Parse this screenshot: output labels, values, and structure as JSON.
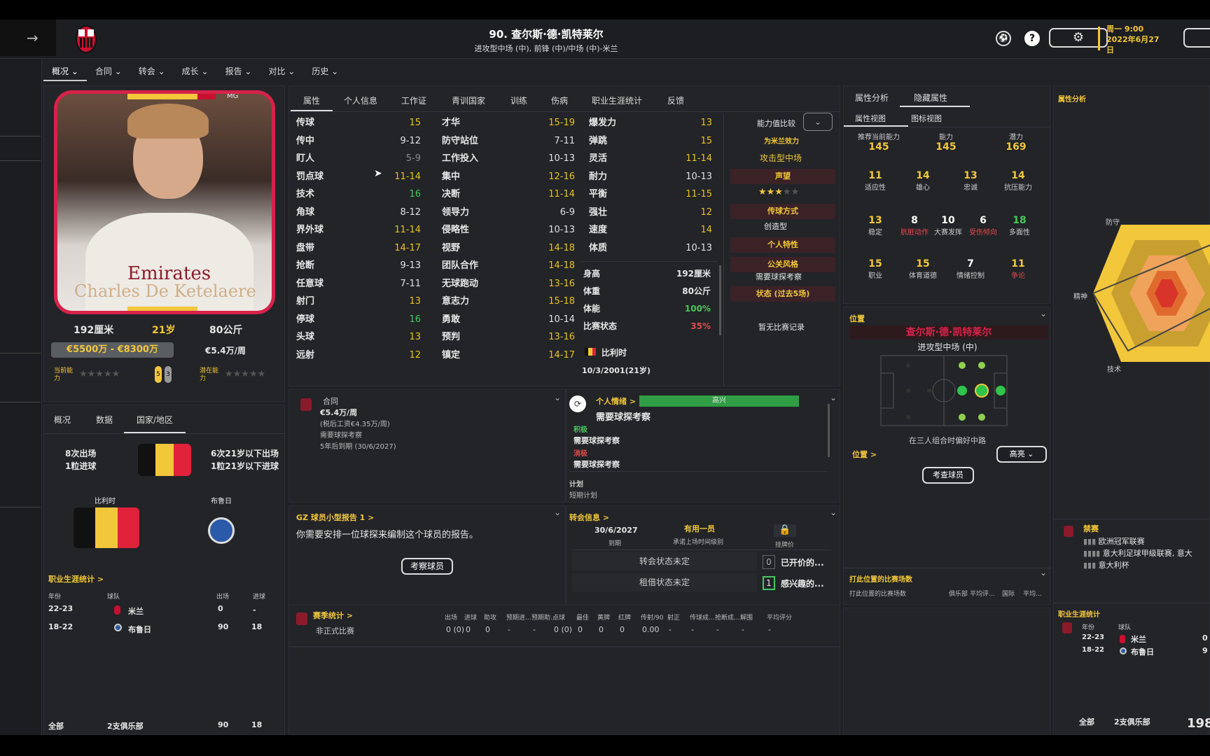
{
  "header": {
    "title": "90. 查尔斯·德·凯特莱尔",
    "subtitle": "进攻型中场 (中), 前锋 (中)/中场 (中)-米兰",
    "date_line1": "周一 9:00",
    "date_line2": "2022年6月27",
    "date_line3": "日",
    "club_badge_text": "ACM"
  },
  "menu": [
    "概况",
    "合同",
    "转会",
    "成长",
    "报告",
    "对比",
    "历史"
  ],
  "player_card": {
    "watermark": "Charles De Ketelaere",
    "height": "192厘米",
    "age": "21岁",
    "weight": "80公斤",
    "value": "€5500万 - €8300万",
    "wage": "€5.4万/周",
    "current_ability": "当前能力",
    "potential_ability": "潜在能力",
    "badge_a": "5",
    "badge_b": "3",
    "mg": "MG"
  },
  "left_tabs": [
    "概况",
    "数据",
    "国家/地区"
  ],
  "nation": {
    "apps": "8次出场",
    "goals": "1粒进球",
    "u21_apps": "6次21岁以下出场",
    "u21_goals": "1粒21岁以下进球",
    "nation": "比利时",
    "club": "布鲁日"
  },
  "career_left": {
    "title": "职业生涯统计 >",
    "headers": [
      "年份",
      "球队",
      "出场",
      "进球"
    ],
    "rows": [
      {
        "y": "22-23",
        "team": "米兰",
        "apps": "0",
        "goals": "-"
      },
      {
        "y": "18-22",
        "team": "布鲁日",
        "apps": "90",
        "goals": "18"
      }
    ],
    "total": {
      "label": "全部",
      "clubs": "2支俱乐部",
      "apps": "90",
      "goals": "18"
    }
  },
  "center_tabs": [
    "属性",
    "个人信息",
    "工作证",
    "青训国家",
    "训练",
    "伤病",
    "职业生涯统计",
    "反馈"
  ],
  "attrs_col1": [
    {
      "k": "传球",
      "v": "15",
      "c": "y"
    },
    {
      "k": "传中",
      "v": "9-12",
      "c": "w"
    },
    {
      "k": "盯人",
      "v": "5-9",
      "c": "gr"
    },
    {
      "k": "罚点球",
      "v": "11-14",
      "c": "y"
    },
    {
      "k": "技术",
      "v": "16",
      "c": "g"
    },
    {
      "k": "角球",
      "v": "8-12",
      "c": "w"
    },
    {
      "k": "界外球",
      "v": "11-14",
      "c": "y"
    },
    {
      "k": "盘带",
      "v": "14-17",
      "c": "y"
    },
    {
      "k": "抢断",
      "v": "9-13",
      "c": "w"
    },
    {
      "k": "任意球",
      "v": "7-11",
      "c": "w"
    },
    {
      "k": "射门",
      "v": "13",
      "c": "y"
    },
    {
      "k": "停球",
      "v": "16",
      "c": "g"
    },
    {
      "k": "头球",
      "v": "13",
      "c": "y"
    },
    {
      "k": "远射",
      "v": "12",
      "c": "y"
    }
  ],
  "attrs_col2": [
    {
      "k": "才华",
      "v": "15-19",
      "c": "y"
    },
    {
      "k": "防守站位",
      "v": "7-11",
      "c": "w"
    },
    {
      "k": "工作投入",
      "v": "10-13",
      "c": "w"
    },
    {
      "k": "集中",
      "v": "12-16",
      "c": "y"
    },
    {
      "k": "决断",
      "v": "11-14",
      "c": "y"
    },
    {
      "k": "领导力",
      "v": "6-9",
      "c": "w"
    },
    {
      "k": "侵略性",
      "v": "10-13",
      "c": "w"
    },
    {
      "k": "视野",
      "v": "14-18",
      "c": "y"
    },
    {
      "k": "团队合作",
      "v": "14-18",
      "c": "y"
    },
    {
      "k": "无球跑动",
      "v": "13-16",
      "c": "y"
    },
    {
      "k": "意志力",
      "v": "15-18",
      "c": "y"
    },
    {
      "k": "勇敢",
      "v": "10-14",
      "c": "w"
    },
    {
      "k": "预判",
      "v": "13-16",
      "c": "y"
    },
    {
      "k": "镇定",
      "v": "14-17",
      "c": "y"
    }
  ],
  "attrs_col3": [
    {
      "k": "爆发力",
      "v": "13",
      "c": "y"
    },
    {
      "k": "弹跳",
      "v": "15",
      "c": "y"
    },
    {
      "k": "灵活",
      "v": "11-14",
      "c": "y"
    },
    {
      "k": "耐力",
      "v": "10-13",
      "c": "w"
    },
    {
      "k": "平衡",
      "v": "11-15",
      "c": "y"
    },
    {
      "k": "强壮",
      "v": "12",
      "c": "y"
    },
    {
      "k": "速度",
      "v": "14",
      "c": "y"
    },
    {
      "k": "体质",
      "v": "10-13",
      "c": "w"
    }
  ],
  "physical": [
    {
      "k": "身高",
      "v": "192厘米"
    },
    {
      "k": "体重",
      "v": "80公斤"
    },
    {
      "k": "体能",
      "v": "100%"
    },
    {
      "k": "比赛状态",
      "v": "35%"
    }
  ],
  "nationality": "比利时",
  "dob": "10/3/2001(21岁)",
  "side": {
    "compare": "能力值比较",
    "for_milan": "为米兰效力",
    "role": "攻击型中场",
    "reputation": "声望",
    "style_title": "传球方式",
    "style_value": "创造型",
    "traits": "个人特性",
    "pr_title": "公关风格",
    "pr_value": "需要球探考察",
    "form": "状态 (过去5场)",
    "no_record": "暂无比赛记录"
  },
  "contract": {
    "title": "合同",
    "wage": "€5.4万/周",
    "after_tax": "(税后工资€4.35万/周)",
    "scout": "需要球探考察",
    "expiry": "5年后到期 (30/6/2027)"
  },
  "mood": {
    "title": "个人情绪 >",
    "level": "高兴",
    "scout": "需要球探考察",
    "pos_title": "积极",
    "pos_value": "需要球探考察",
    "neg_title": "消极",
    "neg_value": "需要球探考察",
    "plan_title": "计划",
    "plan_value": "短期计划"
  },
  "report": {
    "title": "GZ 球员小型报告 1 >",
    "text": "你需要安排一位球探来编制这个球员的报告。",
    "button": "考察球员"
  },
  "transfer": {
    "title": "转会信息 >",
    "date": "30/6/2027",
    "date_label": "到期",
    "status": "有用一员",
    "status_label": "承诺上场时间级别",
    "price_label": "挂牌价",
    "transfer_state": "转会状态未定",
    "loan_state": "租借状态未定",
    "offers_n": "0",
    "offers": "已开价的...",
    "interest_n": "1",
    "interest": "感兴趣的..."
  },
  "season": {
    "title": "赛季统计 >",
    "headers": [
      "出场",
      "进球",
      "助攻",
      "预期进...",
      "预期助...",
      "点球",
      "最佳",
      "黄牌",
      "红牌",
      "传射/90",
      "射正",
      "传球成...",
      "抢断成...",
      "解围",
      "平均评分"
    ],
    "row_label": "非正式比赛",
    "row": [
      "0 (0)",
      "0",
      "0",
      "-",
      "-",
      "0 (0)",
      "0",
      "0",
      "0",
      "0.00",
      "-",
      "-",
      "-",
      "-",
      "-"
    ]
  },
  "right": {
    "tab1": "属性分析",
    "tab2": "隐藏属性",
    "view1": "属性视图",
    "view2": "图标视图",
    "rec": "推荐当前能力",
    "rec_v": "145",
    "ca": "能力",
    "ca_v": "145",
    "pa": "潜力",
    "pa_v": "169",
    "pos_title": "位置",
    "player_name": "查尔斯·德·凯特莱尔",
    "pos_role": "进攻型中场 (中)",
    "trio": "在三人组合时偏好中路",
    "pos_link": "位置 >",
    "highlight": "高亮",
    "view_btn": "考查球员",
    "matches_title": "打此位置的比赛场数",
    "matches_sub": "打此位置的比赛场数",
    "matches_cols": [
      "俱乐部",
      "平均评...",
      "国际",
      "平均..."
    ]
  },
  "hidden": [
    {
      "n": "11",
      "l": "适应性"
    },
    {
      "n": "14",
      "l": "雄心"
    },
    {
      "n": "13",
      "l": "忠诚"
    },
    {
      "n": "14",
      "l": "抗压能力"
    },
    {
      "n": "13",
      "l": "稳定"
    },
    {
      "n": "8",
      "l": "肮脏动作",
      "lc": "r",
      "nc": "w"
    },
    {
      "n": "10",
      "l": "大赛发挥",
      "nc": "w"
    },
    {
      "n": "6",
      "l": "受伤倾向",
      "lc": "r",
      "nc": "w"
    },
    {
      "n": "18",
      "l": "多面性",
      "nc": "g"
    },
    {
      "n": "15",
      "l": "职业"
    },
    {
      "n": "15",
      "l": "体育道德"
    },
    {
      "n": "7",
      "l": "情绪控制",
      "nc": "w"
    },
    {
      "n": "11",
      "l": "争论",
      "lc": "r"
    }
  ],
  "far_right": {
    "title": "属性分析",
    "def": "防守",
    "mental": "精神",
    "tech": "技术",
    "ban_title": "禁赛",
    "bans": [
      "欧洲冠军联赛",
      "意大利足球甲级联赛, 意大",
      "意大利杯"
    ],
    "career_title": "职业生涯统计",
    "headers": [
      "年份",
      "球队"
    ],
    "rows": [
      {
        "y": "22-23",
        "team": "米兰",
        "v": "0"
      },
      {
        "y": "18-22",
        "team": "布鲁日",
        "v": "9"
      }
    ],
    "total": "全部",
    "clubs": "2支俱乐部",
    "total_v": "198"
  }
}
